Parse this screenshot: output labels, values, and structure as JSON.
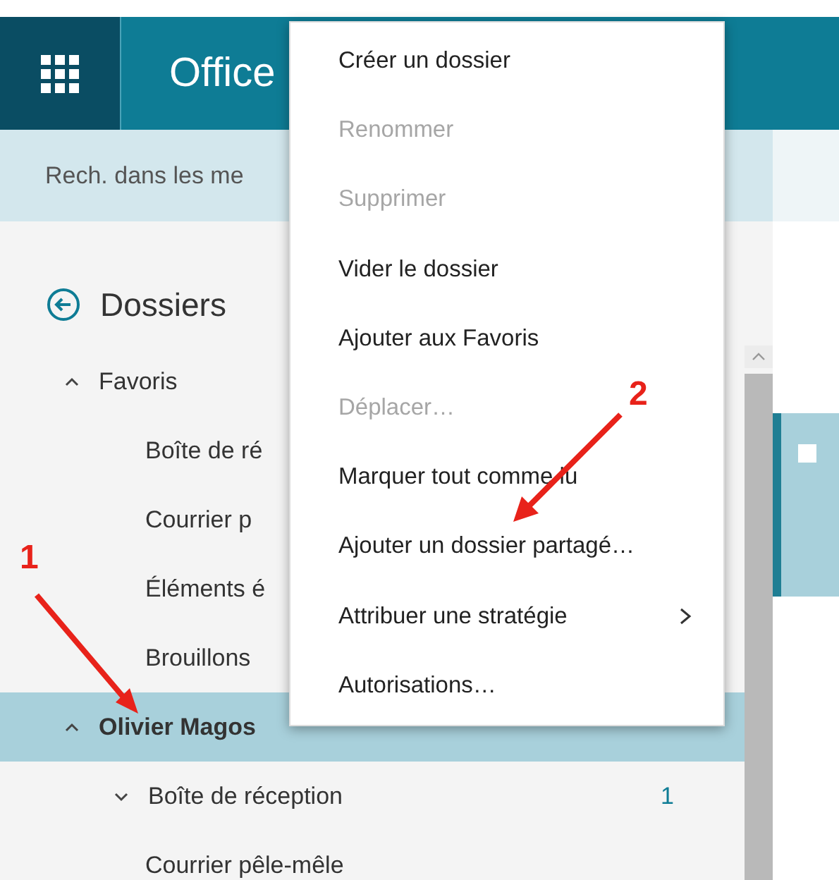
{
  "header": {
    "title": "Office"
  },
  "search": {
    "placeholder": "Rech. dans les me"
  },
  "sidebar": {
    "heading": "Dossiers",
    "groups": [
      {
        "label": "Favoris",
        "expanded": true,
        "selected": false,
        "children": [
          {
            "label": "Boîte de ré"
          },
          {
            "label": "Courrier p"
          },
          {
            "label": "Éléments é"
          },
          {
            "label": "Brouillons"
          }
        ]
      },
      {
        "label": "Olivier Magos",
        "expanded": true,
        "selected": true,
        "children": [
          {
            "label": "Boîte de réception",
            "expanded": false,
            "count": "1"
          },
          {
            "label": "Courrier pêle-mêle"
          }
        ]
      }
    ]
  },
  "message_list": {
    "rows": [
      {
        "selected": true
      }
    ]
  },
  "context_menu": {
    "items": [
      {
        "label": "Créer un dossier",
        "disabled": false
      },
      {
        "label": "Renommer",
        "disabled": true
      },
      {
        "label": "Supprimer",
        "disabled": true
      },
      {
        "label": "Vider le dossier",
        "disabled": false
      },
      {
        "label": "Ajouter aux Favoris",
        "disabled": false
      },
      {
        "label": "Déplacer…",
        "disabled": true
      },
      {
        "label": "Marquer tout comme lu",
        "disabled": false
      },
      {
        "label": "Ajouter un dossier partagé…",
        "disabled": false
      },
      {
        "label": "Attribuer une stratégie",
        "disabled": false,
        "submenu": true
      },
      {
        "label": "Autorisations…",
        "disabled": false
      }
    ]
  },
  "annotations": [
    {
      "label": "1"
    },
    {
      "label": "2"
    }
  ]
}
